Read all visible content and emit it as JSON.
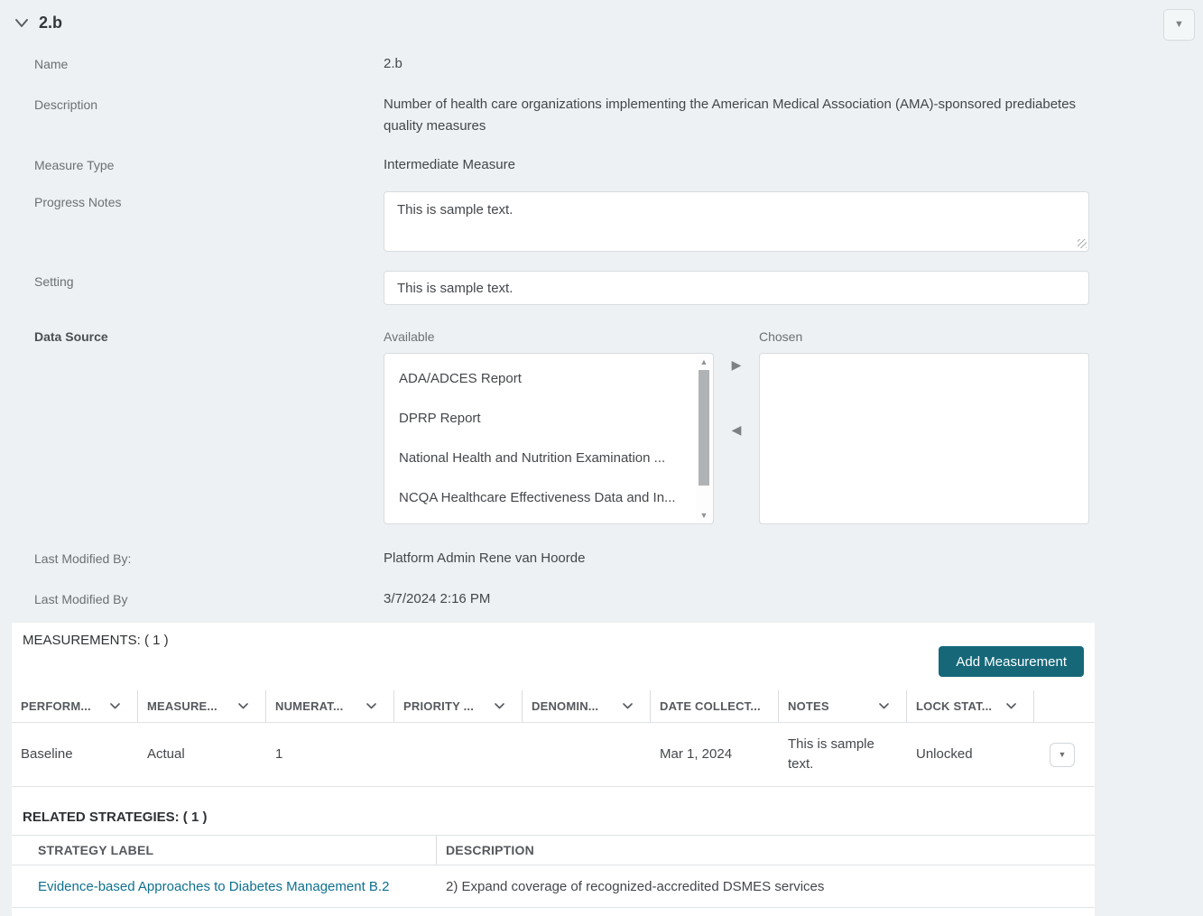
{
  "header": {
    "title": "2.b"
  },
  "icons": {
    "triangle_down": "▼",
    "triangle_up": "▲",
    "triangle_right": "▶",
    "triangle_left": "◀"
  },
  "colors": {
    "accent_teal": "#166879",
    "link_teal": "#0e7090",
    "page_bg": "#edf1f3"
  },
  "fields": {
    "name": {
      "label": "Name",
      "value": "2.b"
    },
    "description": {
      "label": "Description",
      "value": "Number of health care organizations implementing the American Medical Association (AMA)-sponsored prediabetes quality measures"
    },
    "measure_type": {
      "label": "Measure Type",
      "value": "Intermediate Measure"
    },
    "progress_notes": {
      "label": "Progress Notes",
      "value": "This is sample text."
    },
    "setting": {
      "label": "Setting",
      "value": "This is sample text."
    },
    "data_source": {
      "label": "Data Source",
      "available_label": "Available",
      "chosen_label": "Chosen",
      "available_options": [
        "ADA/ADCES Report",
        "DPRP Report",
        "National Health and Nutrition Examination ...",
        "NCQA Healthcare Effectiveness Data and In..."
      ],
      "chosen_options": []
    },
    "last_modified_by": {
      "label": "Last Modified By:",
      "value": "Platform Admin Rene van Hoorde"
    },
    "last_modified_date": {
      "label": "Last Modified By",
      "value": "3/7/2024 2:16 PM"
    }
  },
  "measurements": {
    "section_title": "MEASUREMENTS: ( 1 )",
    "add_button_label": "Add Measurement",
    "columns": [
      {
        "label": "PERFORM...",
        "sortable": true
      },
      {
        "label": "MEASURE...",
        "sortable": true
      },
      {
        "label": "NUMERAT...",
        "sortable": true
      },
      {
        "label": "PRIORITY ...",
        "sortable": true
      },
      {
        "label": "DENOMIN...",
        "sortable": true
      },
      {
        "label": "DATE COLLECT...",
        "sortable": false
      },
      {
        "label": "NOTES",
        "sortable": true
      },
      {
        "label": "LOCK STAT...",
        "sortable": true
      },
      {
        "label": "",
        "sortable": false
      }
    ],
    "rows": [
      {
        "performance": "Baseline",
        "measure": "Actual",
        "numerator": "1",
        "priority": "",
        "denominator": "",
        "date_collected": "Mar 1, 2024",
        "notes": "This is sample text.",
        "lock_status": "Unlocked"
      }
    ]
  },
  "related_strategies": {
    "section_title": "RELATED STRATEGIES: ( 1 )",
    "columns": [
      "STRATEGY LABEL",
      "DESCRIPTION"
    ],
    "rows": [
      {
        "strategy_label": "Evidence-based Approaches to Diabetes Management B.2",
        "description": "2) Expand coverage of recognized-accredited DSMES services"
      }
    ]
  }
}
